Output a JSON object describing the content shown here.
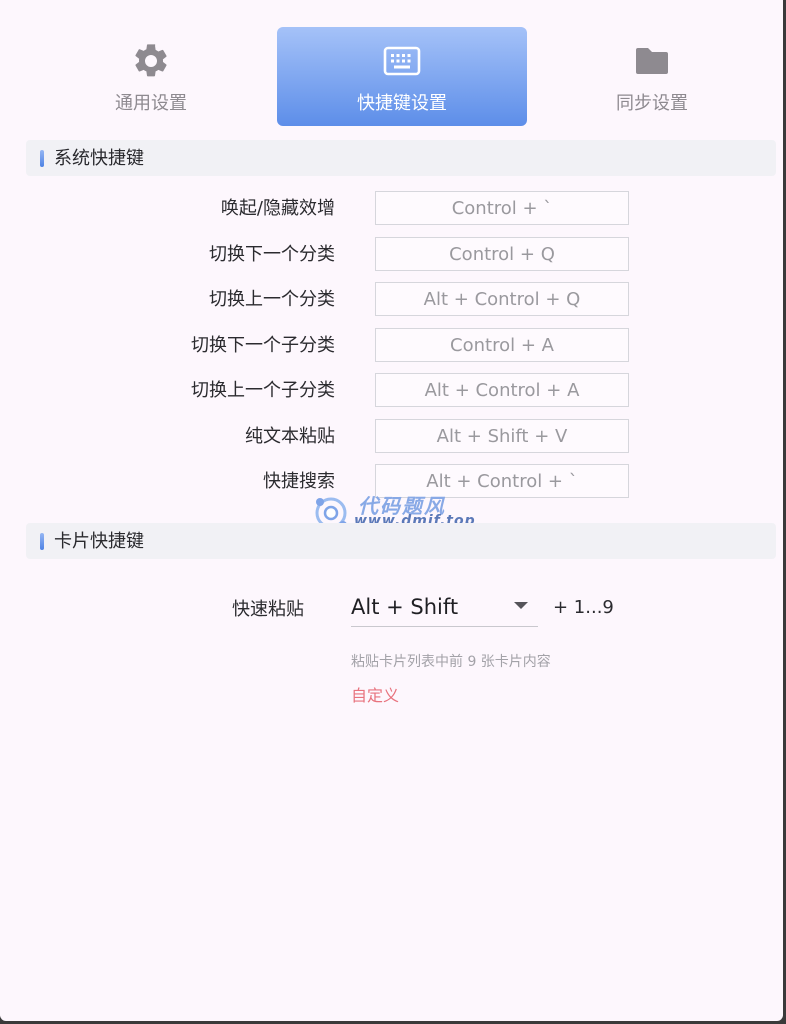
{
  "tabs": [
    {
      "label": "通用设置",
      "icon": "gear-icon"
    },
    {
      "label": "快捷键设置",
      "icon": "keyboard-icon",
      "active": true
    },
    {
      "label": "同步设置",
      "icon": "folder-icon"
    }
  ],
  "system_section": {
    "title": "系统快捷键",
    "rows": [
      {
        "label": "唤起/隐藏效增",
        "shortcut": "Control + `"
      },
      {
        "label": "切换下一个分类",
        "shortcut": "Control + Q"
      },
      {
        "label": "切换上一个分类",
        "shortcut": "Alt + Control + Q"
      },
      {
        "label": "切换下一个子分类",
        "shortcut": "Control + A"
      },
      {
        "label": "切换上一个子分类",
        "shortcut": "Alt + Control + A"
      },
      {
        "label": "纯文本粘贴",
        "shortcut": "Alt + Shift + V"
      },
      {
        "label": "快捷搜索",
        "shortcut": "Alt + Control + `"
      }
    ]
  },
  "card_section": {
    "title": "卡片快捷键",
    "quick_paste_label": "快速粘贴",
    "modifier_value": "Alt + Shift",
    "suffix": "+ 1...9",
    "hint": "粘贴卡片列表中前 9 张卡片内容",
    "customize_label": "自定义"
  },
  "watermark": {
    "text": "代码题风",
    "url": "www.dmjf.top"
  },
  "colors": {
    "background": "#fdf7fd",
    "accent_gradient_top": "#a5c2f8",
    "accent_gradient_bottom": "#5d8ee9",
    "link": "#e8737e"
  }
}
